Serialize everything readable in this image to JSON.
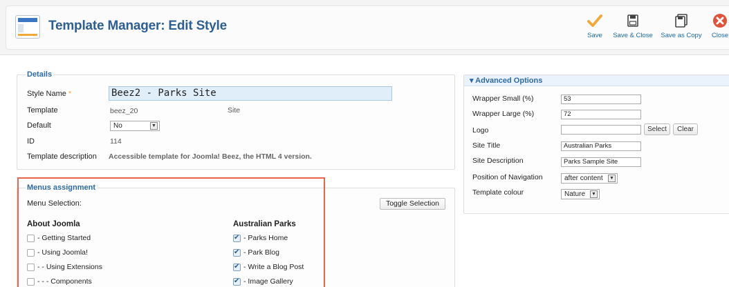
{
  "toolbar": {
    "title": "Template Manager: Edit Style",
    "buttons": {
      "save": "Save",
      "save_close": "Save & Close",
      "save_copy": "Save as Copy",
      "close": "Close"
    }
  },
  "details": {
    "legend": "Details",
    "style_name_label": "Style Name",
    "required_mark": "*",
    "style_name_value": "Beez2 - Parks Site",
    "template_label": "Template",
    "template_value": "beez_20",
    "template_client": "Site",
    "default_label": "Default",
    "default_value": "No",
    "id_label": "ID",
    "id_value": "114",
    "desc_label": "Template description",
    "desc_value": "Accessible template for Joomla! Beez, the HTML 4 version."
  },
  "menus": {
    "legend": "Menus assignment",
    "selection_label": "Menu Selection:",
    "toggle_button": "Toggle Selection",
    "columns": [
      {
        "heading": "About Joomla",
        "items": [
          {
            "label": "- Getting Started",
            "checked": false
          },
          {
            "label": "- Using Joomla!",
            "checked": false
          },
          {
            "label": "- - Using Extensions",
            "checked": false
          },
          {
            "label": "- - - Components",
            "checked": false
          }
        ]
      },
      {
        "heading": "Australian Parks",
        "items": [
          {
            "label": "- Parks Home",
            "checked": true
          },
          {
            "label": "- Park Blog",
            "checked": true
          },
          {
            "label": "- Write a Blog Post",
            "checked": true
          },
          {
            "label": "- Image Gallery",
            "checked": true
          }
        ]
      }
    ]
  },
  "advanced": {
    "heading": "▾ Advanced Options",
    "wrapper_small_label": "Wrapper Small (%)",
    "wrapper_small_value": "53",
    "wrapper_large_label": "Wrapper Large (%)",
    "wrapper_large_value": "72",
    "logo_label": "Logo",
    "logo_value": "",
    "select_button": "Select",
    "clear_button": "Clear",
    "site_title_label": "Site Title",
    "site_title_value": "Australian Parks",
    "site_desc_label": "Site Description",
    "site_desc_value": "Parks Sample Site",
    "nav_pos_label": "Position of Navigation",
    "nav_pos_value": "after content",
    "colour_label": "Template colour",
    "colour_value": "Nature"
  },
  "colors": {
    "accent_blue": "#2d5f92",
    "save_icon": "#f0a93a",
    "close_icon": "#e0533a",
    "highlight_box": "#e9644e"
  }
}
